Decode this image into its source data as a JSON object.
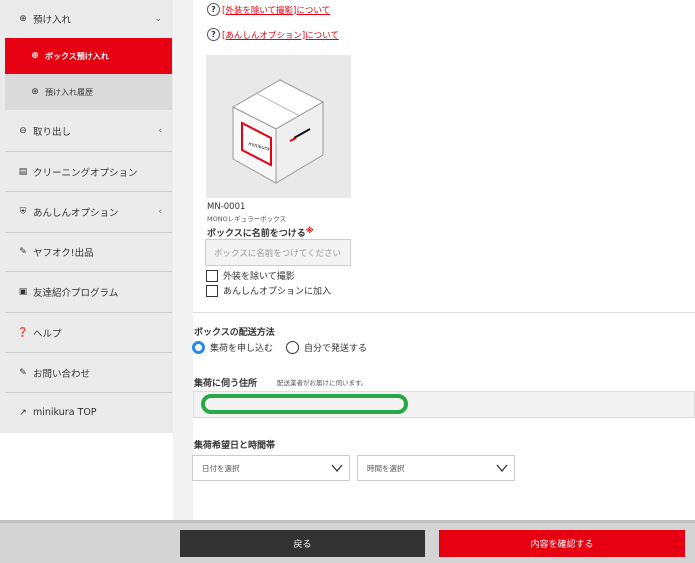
{
  "sidebar": {
    "items": [
      {
        "label": "預け入れ",
        "icon": "circle-plus-icon",
        "chevron": "⌄"
      },
      {
        "label": "ボックス預け入れ",
        "icon": "circle-plus-icon",
        "active": true
      },
      {
        "label": "預け入れ履歴",
        "icon": "circle-plus-icon",
        "sub": true
      },
      {
        "label": "取り出し",
        "icon": "circle-minus-icon",
        "chevron": "‹"
      },
      {
        "label": "クリーニングオプション",
        "icon": "clipboard-icon"
      },
      {
        "label": "あんしんオプション",
        "icon": "shield-icon",
        "chevron": "‹"
      },
      {
        "label": "ヤフオク!出品",
        "icon": "gavel-icon"
      },
      {
        "label": "友達紹介プログラム",
        "icon": "gift-icon"
      },
      {
        "label": "ヘルプ",
        "icon": "question-circle-icon"
      },
      {
        "label": "お問い合わせ",
        "icon": "edit-icon"
      },
      {
        "label": "minikura TOP",
        "icon": "external-link-icon"
      }
    ]
  },
  "help_links": {
    "exterior_photo": "[外装を除いて撮影]について",
    "anshin_option": "[あんしんオプション]について"
  },
  "product": {
    "code": "MN-0001",
    "type": "MONOレギュラーボックス",
    "box_brand": "minikura"
  },
  "name_field": {
    "label": "ボックスに名前をつける",
    "required_mark": "※",
    "placeholder": "ボックスに名前をつけてください"
  },
  "checkboxes": {
    "exclude_exterior": "外装を除いて撮影",
    "add_anshin": "あんしんオプションに加入"
  },
  "delivery": {
    "title": "ボックスの配送方法",
    "option_pickup": "集荷を申し込む",
    "option_self": "自分で発送する",
    "selected": "集荷を申し込む"
  },
  "address": {
    "title": "集荷に伺う住所",
    "note": "配送業者がお届けに伺います。"
  },
  "pickup_time": {
    "title": "集荷希望日と時間帯",
    "date_placeholder": "日付を選択",
    "time_placeholder": "時間を選択"
  },
  "footer": {
    "back_label": "戻る",
    "confirm_label": "内容を確認する"
  },
  "colors": {
    "accent": "#e60012",
    "radio": "#2b86e6",
    "highlight": "#27a844",
    "dark_button": "#333333"
  }
}
